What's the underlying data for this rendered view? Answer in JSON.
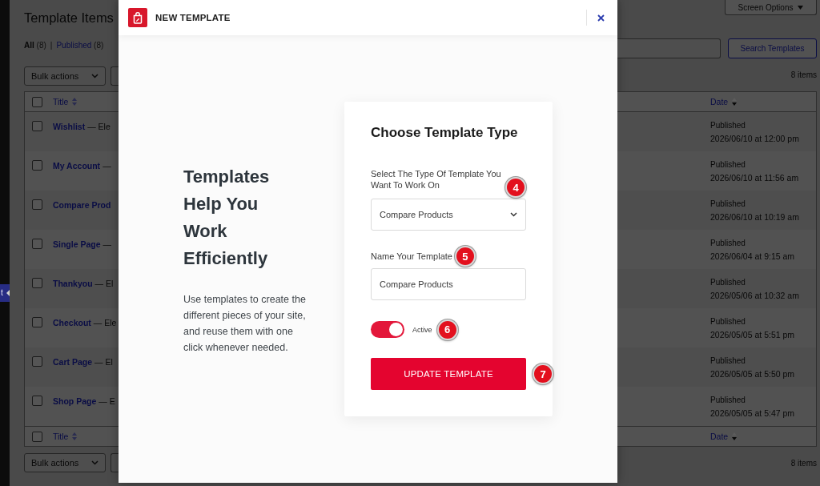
{
  "admin_sidebar": {
    "menu_tab": "t"
  },
  "page": {
    "title": "Template Items",
    "screen_options": "Screen Options",
    "filters": [
      {
        "label": "All",
        "count": "(8)",
        "selected": true
      },
      {
        "label": "Published",
        "count": "(8)",
        "selected": false
      }
    ],
    "filter_separator": "|",
    "search_button": "Search Templates",
    "top_nav": {
      "bulk_actions": "Bulk actions",
      "item_count": "8 items"
    },
    "table": {
      "all_checked": false,
      "columns": [
        {
          "label": "Title",
          "sorted": false
        },
        {
          "label": "Date",
          "sorted": true
        }
      ],
      "rows": [
        {
          "title": "Wishlist",
          "suffix": "— Ele",
          "checked": false,
          "status": "Published",
          "date": "2026/06/10 at 12:00 pm"
        },
        {
          "title": "My Account",
          "suffix": "—",
          "checked": false,
          "status": "Published",
          "date": "2026/06/10 at 11:56 am"
        },
        {
          "title": "Compare Prod",
          "checked": false,
          "status": "Published",
          "date": "2026/06/10 at 10:19 am"
        },
        {
          "title": "Single Page",
          "suffix": "—",
          "checked": false,
          "status": "Published",
          "date": "2026/06/04 at 9:15 am"
        },
        {
          "title": "Thankyou",
          "suffix": "— El",
          "checked": false,
          "status": "Published",
          "date": "2026/05/06 at 10:32 am"
        },
        {
          "title": "Checkout",
          "suffix": "— Ele",
          "checked": false,
          "status": "Published",
          "date": "2026/05/05 at 5:51 pm"
        },
        {
          "title": "Cart Page",
          "suffix": "— El",
          "checked": false,
          "status": "Published",
          "date": "2026/05/05 at 5:50 pm"
        },
        {
          "title": "Shop Page",
          "suffix": "— E",
          "checked": false,
          "status": "Published",
          "date": "2026/05/05 at 5:47 pm"
        }
      ],
      "footer_columns": [
        {
          "label": "Title",
          "sorted": false
        },
        {
          "label": "Date",
          "sorted": true
        }
      ]
    },
    "bottom_nav": {
      "bulk_actions": "Bulk actions",
      "item_count": "8 items"
    }
  },
  "modal": {
    "title": "NEW TEMPLATE",
    "intro": {
      "heading": "Templates Help You Work Efficiently",
      "text": "Use templates to create the different pieces of your site, and reuse them with one click whenever needed."
    },
    "form": {
      "heading": "Choose Template Type",
      "fields": [
        {
          "kind": "select",
          "label": "Select The Type Of Template You Want To Work On",
          "value": "Compare Products",
          "marker": "4"
        },
        {
          "kind": "text",
          "label": "Name Your Template",
          "value": "Compare Products",
          "marker": "5"
        },
        {
          "kind": "toggle",
          "label": "Active",
          "on": true,
          "marker": "6"
        },
        {
          "kind": "button",
          "label": "UPDATE TEMPLATE",
          "marker": "7"
        }
      ]
    }
  }
}
